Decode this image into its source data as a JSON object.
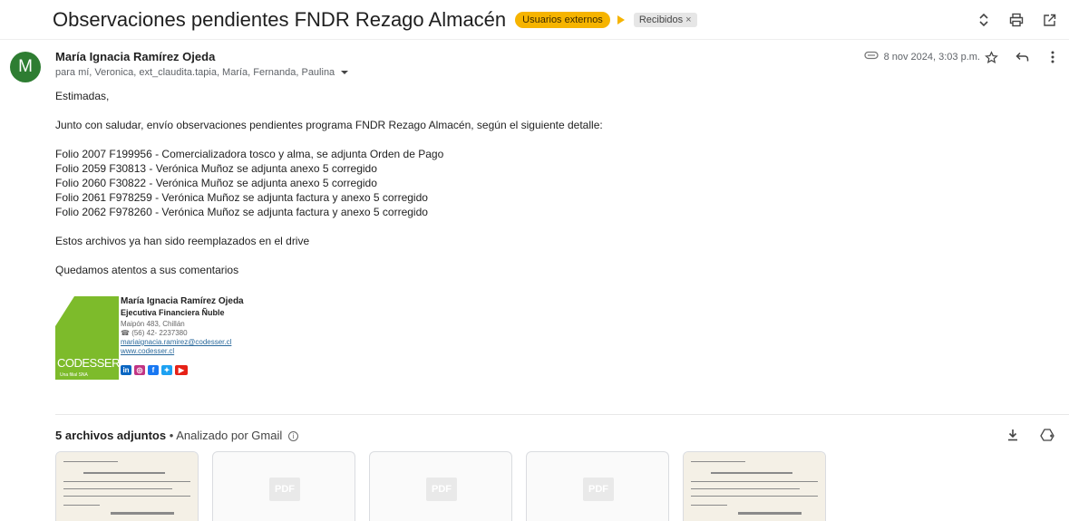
{
  "subject": {
    "title": "Observaciones pendientes FNDR Rezago Almacén",
    "labels": [
      {
        "text": "Usuarios externos",
        "color": "#f6b400"
      },
      {
        "text": "Recibidos",
        "close": "×"
      }
    ]
  },
  "top_icons": [
    "unfold-icon",
    "print-icon",
    "open-in-new-window-icon"
  ],
  "message": {
    "avatar_letter": "M",
    "sender": "María Ignacia Ramírez Ojeda",
    "recipients": "para mí, Veronica, ext_claudita.tapia, María, Fernanda, Paulina",
    "date": "8 nov 2024, 3:03 p.m.",
    "icons": [
      "attachment-icon",
      "star-icon",
      "reply-icon",
      "more-icon"
    ]
  },
  "body": {
    "greeting": "Estimadas,",
    "intro": "Junto con saludar, envío observaciones pendientes programa FNDR Rezago Almacén, según el siguiente detalle:",
    "items": [
      "Folio 2007 F199956 - Comercializadora tosco y alma, se adjunta Orden de Pago",
      "Folio 2059 F30813 - Verónica Muñoz se adjunta anexo 5 corregido",
      "Folio 2060 F30822 - Verónica Muñoz se adjunta anexo 5 corregido",
      "Folio 2061 F978259 - Verónica Muñoz se adjunta factura y anexo 5 corregido",
      "Folio 2062 F978260 - Verónica Muñoz se adjunta factura y anexo 5 corregido"
    ],
    "note": "Estos archivos ya han sido reemplazados en el drive",
    "closing": "Quedamos atentos a sus comentarios"
  },
  "signature": {
    "name": "María Ignacia Ramírez Ojeda",
    "role": "Ejecutiva Financiera Ñuble",
    "address": "Maipón 483, Chillán",
    "phone": "☎ (56) 42- 2237380",
    "email": "mariaignacia.ramirez@codesser.cl",
    "web": "www.codesser.cl",
    "logo_text": "CODESSER",
    "logo_sub": "Una filial SNA",
    "social": [
      {
        "name": "linkedin-icon",
        "glyph": "in",
        "color": "#0a66c2"
      },
      {
        "name": "instagram-icon",
        "glyph": "◎",
        "color": "#c13584"
      },
      {
        "name": "facebook-icon",
        "glyph": "f",
        "color": "#1877f2"
      },
      {
        "name": "twitter-icon",
        "glyph": "✦",
        "color": "#1da1f2"
      },
      {
        "name": "youtube-icon",
        "glyph": "▶",
        "color": "#e62117"
      }
    ]
  },
  "attachments": {
    "count_label": "5 archivos adjuntos",
    "separator": "•",
    "scanned_by": "Analizado por Gmail",
    "info_glyph": "i",
    "icons": [
      "download-all-icon",
      "add-to-drive-icon"
    ],
    "items": [
      {
        "kind": "scan"
      },
      {
        "kind": "pdf",
        "badge": "PDF"
      },
      {
        "kind": "pdf",
        "badge": "PDF"
      },
      {
        "kind": "pdf",
        "badge": "PDF"
      },
      {
        "kind": "scan"
      }
    ]
  }
}
